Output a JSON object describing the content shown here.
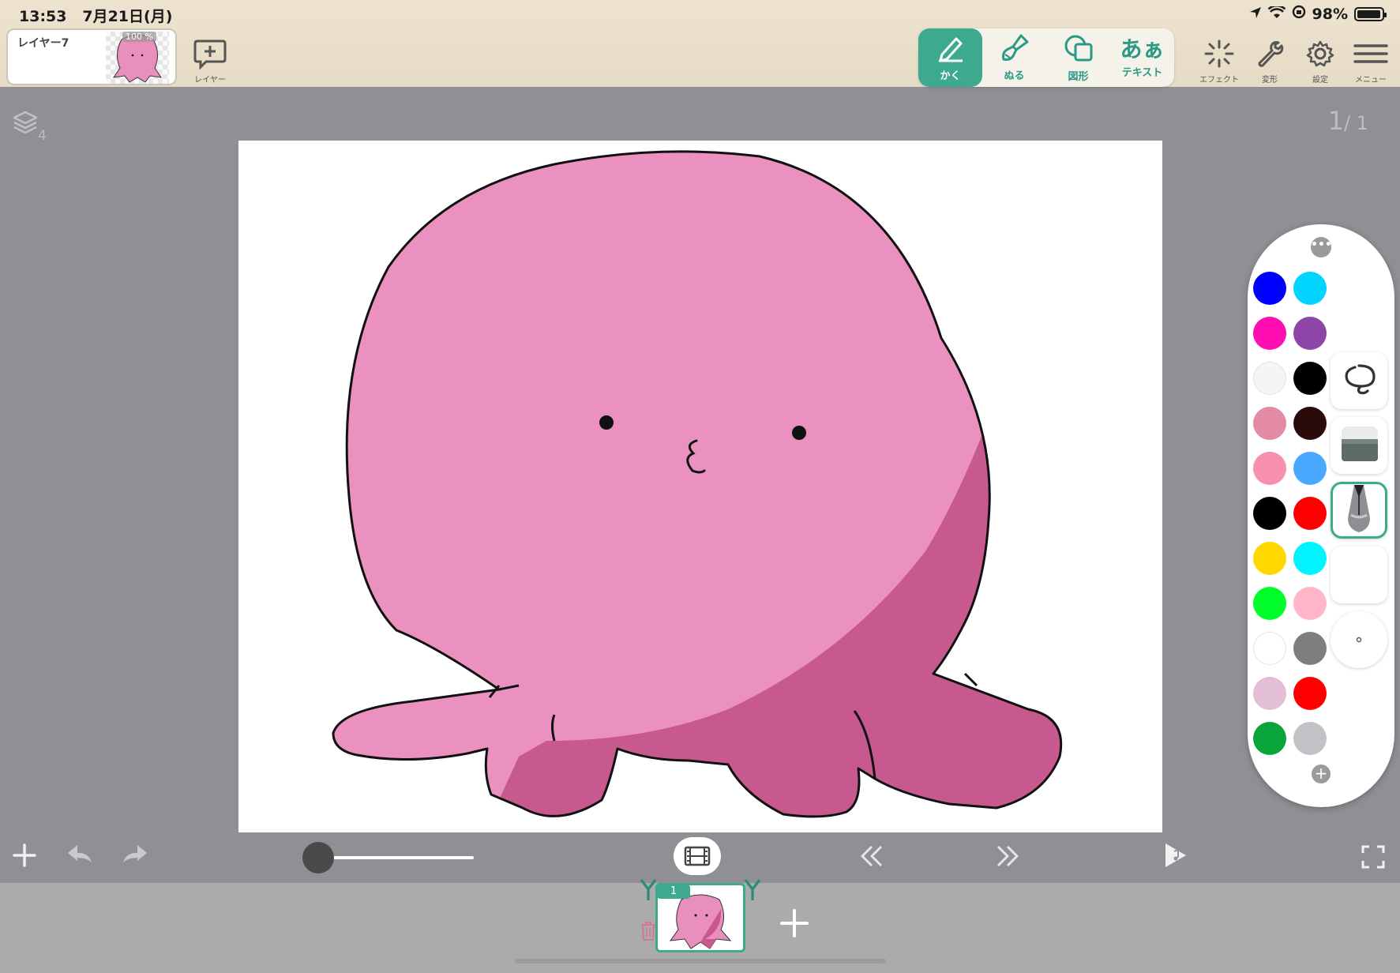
{
  "status_bar": {
    "time": "13:53",
    "date": "7月21日(月)",
    "battery": "98%",
    "battery_level": 0.98
  },
  "layer_card": {
    "name": "レイヤー7",
    "opacity": "100 %"
  },
  "add_layer": {
    "label": "レイヤー"
  },
  "tools": [
    {
      "label": "かく",
      "icon": "pencil-icon",
      "active": true
    },
    {
      "label": "ぬる",
      "icon": "fill-brush-icon",
      "active": false
    },
    {
      "label": "図形",
      "icon": "shape-icon",
      "active": false
    },
    {
      "label": "テキスト",
      "icon_text": "あぁ",
      "active": false
    }
  ],
  "right_tools": [
    {
      "label": "エフェクト",
      "icon": "effects-icon"
    },
    {
      "label": "変形",
      "icon": "wrench-icon"
    },
    {
      "label": "設定",
      "icon": "gear-icon"
    },
    {
      "label": "メニュー",
      "icon": "menu-icon"
    }
  ],
  "layers": {
    "count": "4"
  },
  "page": {
    "current": "1",
    "total": "/ 1"
  },
  "canvas": {
    "character_colors": {
      "body": "#eb91bf",
      "shade": "#c7598f",
      "outline": "#111111"
    }
  },
  "palette": {
    "swatches": [
      "#0000ff",
      "#00d4ff",
      "#ff0fb1",
      "#8e45a8",
      "#f4f5f7",
      "#000000",
      "#e58aa4",
      "#2a0b0b",
      "#f78fae",
      "#4aa9ff",
      "#000000",
      "#ff0000",
      "#ffd800",
      "#00f4ff",
      "#00ff2a",
      "#ffb6c8",
      "#ffffff",
      "#7e7e7e",
      "#e2bfd6",
      "#ff0000",
      "#0aa53a",
      "#c2c2c6"
    ],
    "brushes": [
      {
        "icon": "lasso-icon"
      },
      {
        "icon": "eraser-icon"
      },
      {
        "icon": "pen-nib-icon",
        "active": true
      },
      {
        "icon": "color-preview-icon",
        "color": "#ffffff"
      },
      {
        "icon": "brush-size-icon"
      }
    ]
  },
  "timeline": {
    "frame_number": "1",
    "accent": "#3da98e"
  }
}
